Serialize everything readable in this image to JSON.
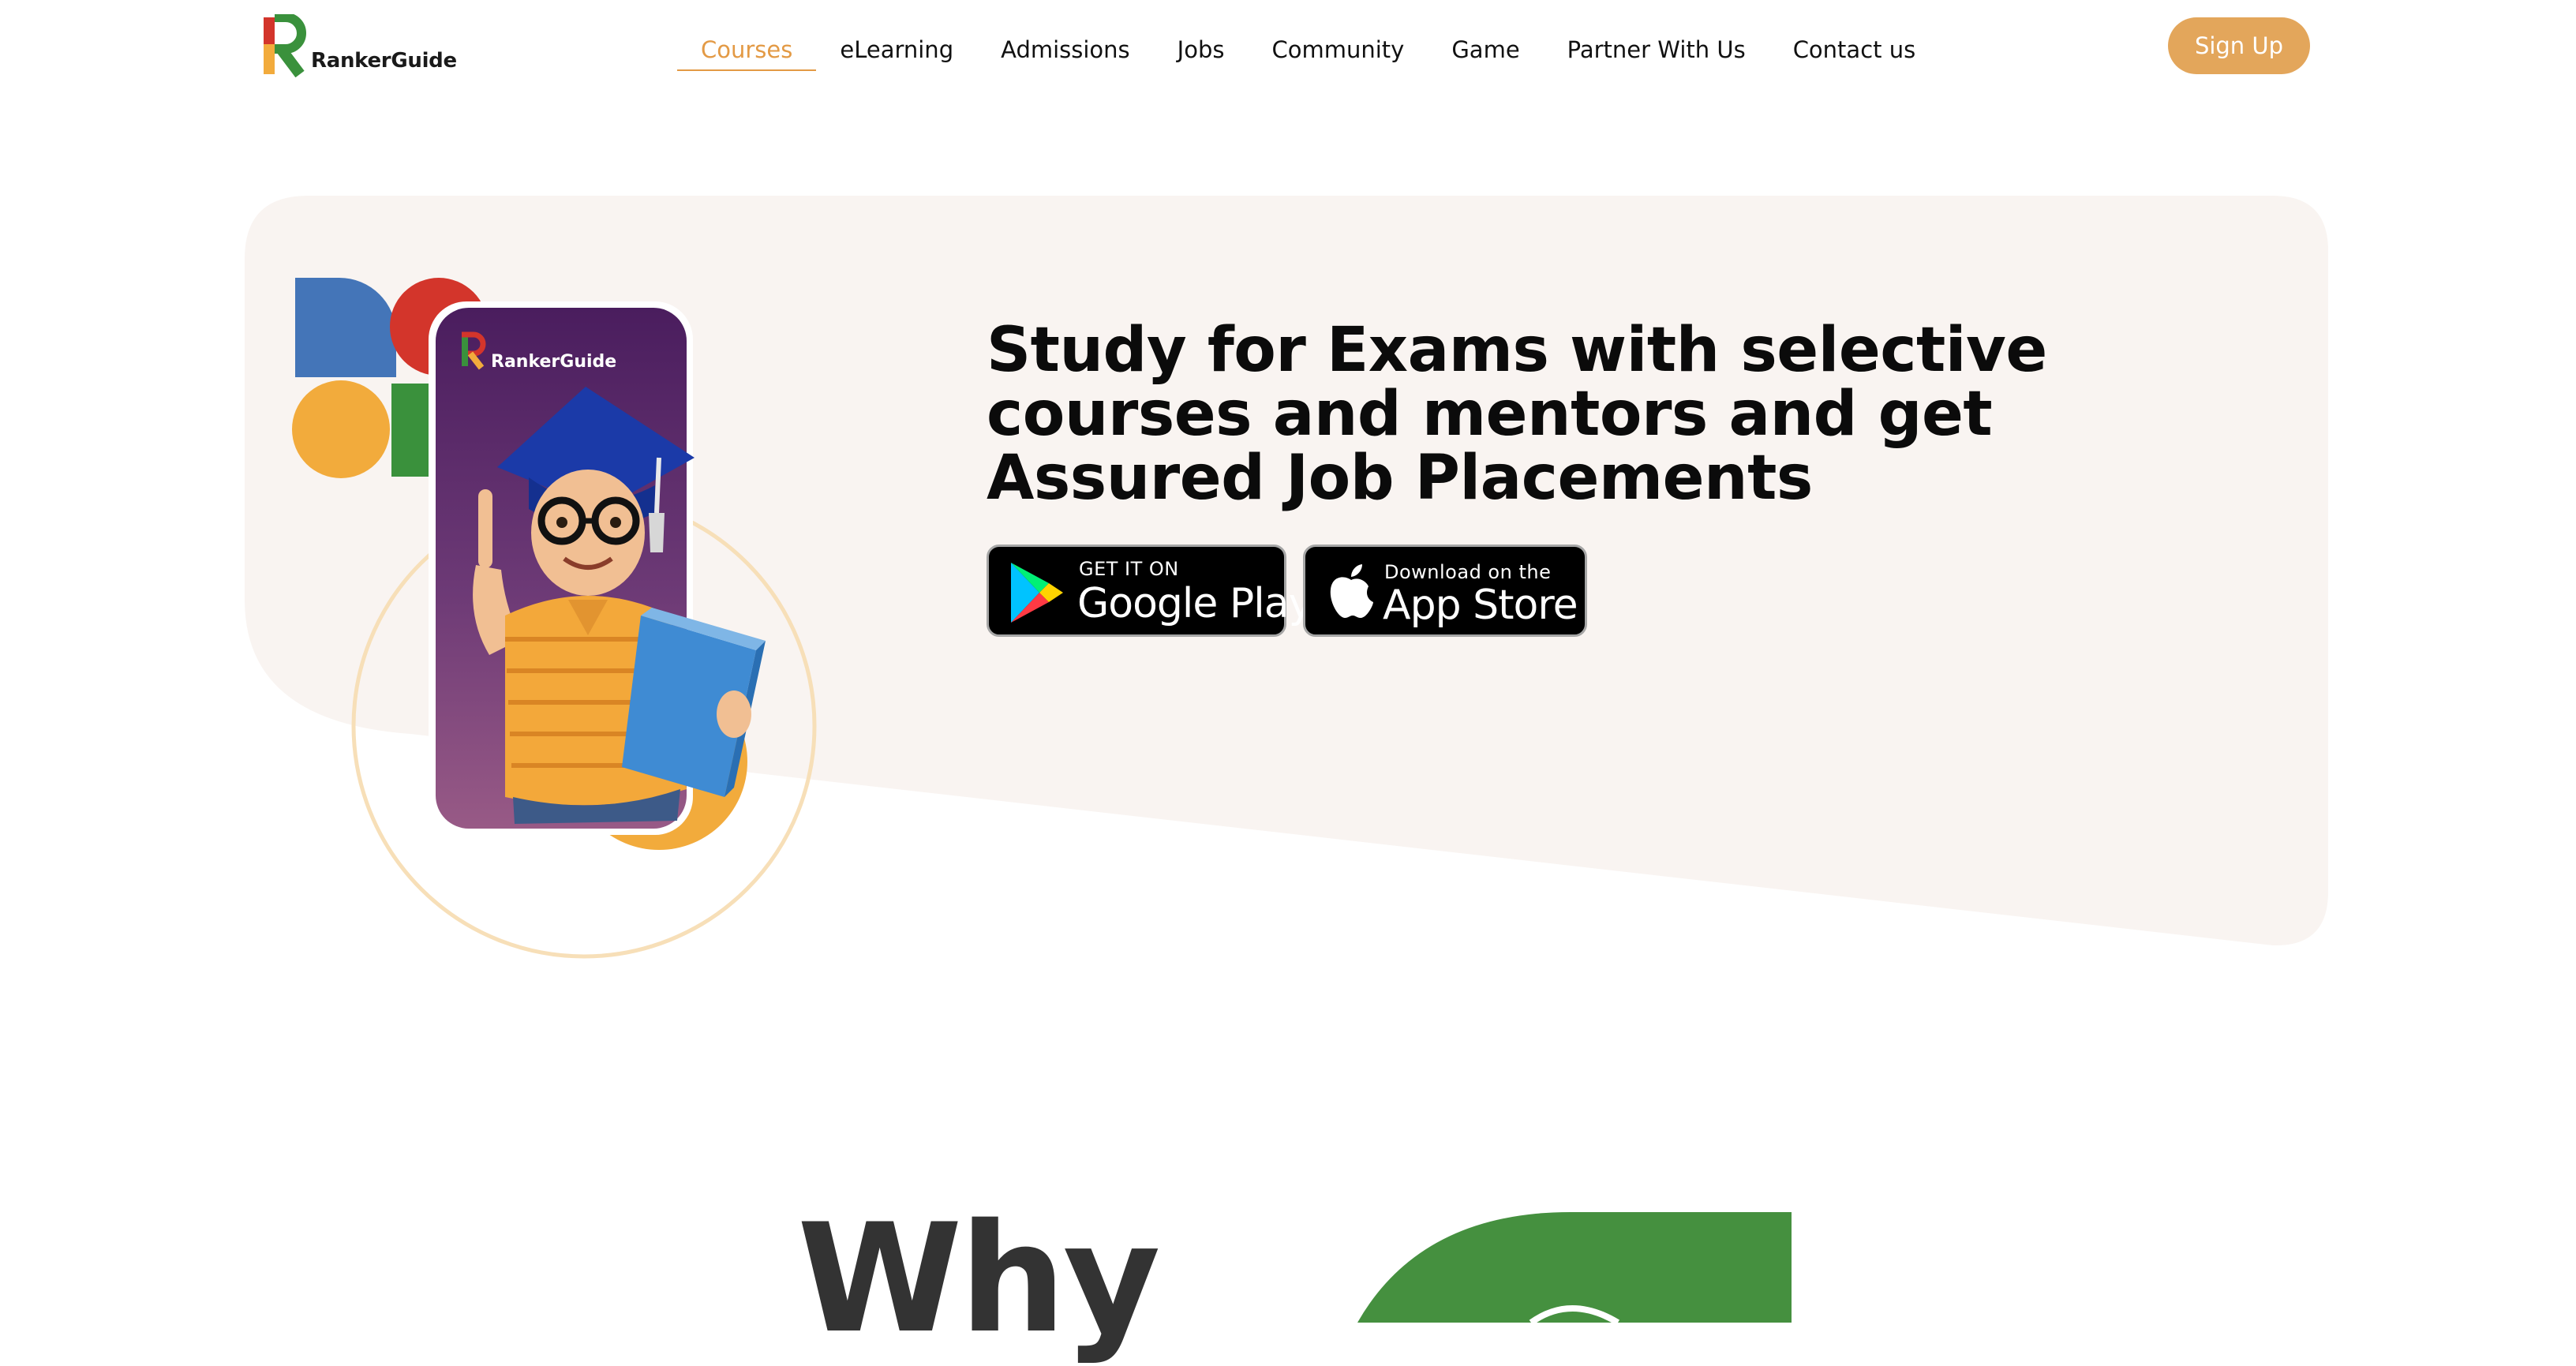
{
  "brand": {
    "name": "RankerGuide",
    "colors": {
      "accent": "#e39a45",
      "button": "#e3a65b",
      "hero_bg": "#f9f4f1",
      "green": "#45903f"
    }
  },
  "nav": {
    "items": [
      {
        "label": "Courses",
        "active": true
      },
      {
        "label": "eLearning"
      },
      {
        "label": "Admissions"
      },
      {
        "label": "Jobs"
      },
      {
        "label": "Community"
      },
      {
        "label": "Game"
      },
      {
        "label": "Partner With Us"
      },
      {
        "label": "Contact us"
      }
    ],
    "signup_label": "Sign Up"
  },
  "hero": {
    "title": "Study for Exams with selective courses and mentors and get Assured Job Placements",
    "phone_brand": "RankerGuide",
    "google_play": {
      "small": "GET IT ON",
      "big": "Google Play",
      "icon": "google-play-icon"
    },
    "app_store": {
      "small": "Download on the",
      "big": "App Store",
      "icon": "apple-icon"
    }
  },
  "why_section": {
    "heading": "Why"
  }
}
